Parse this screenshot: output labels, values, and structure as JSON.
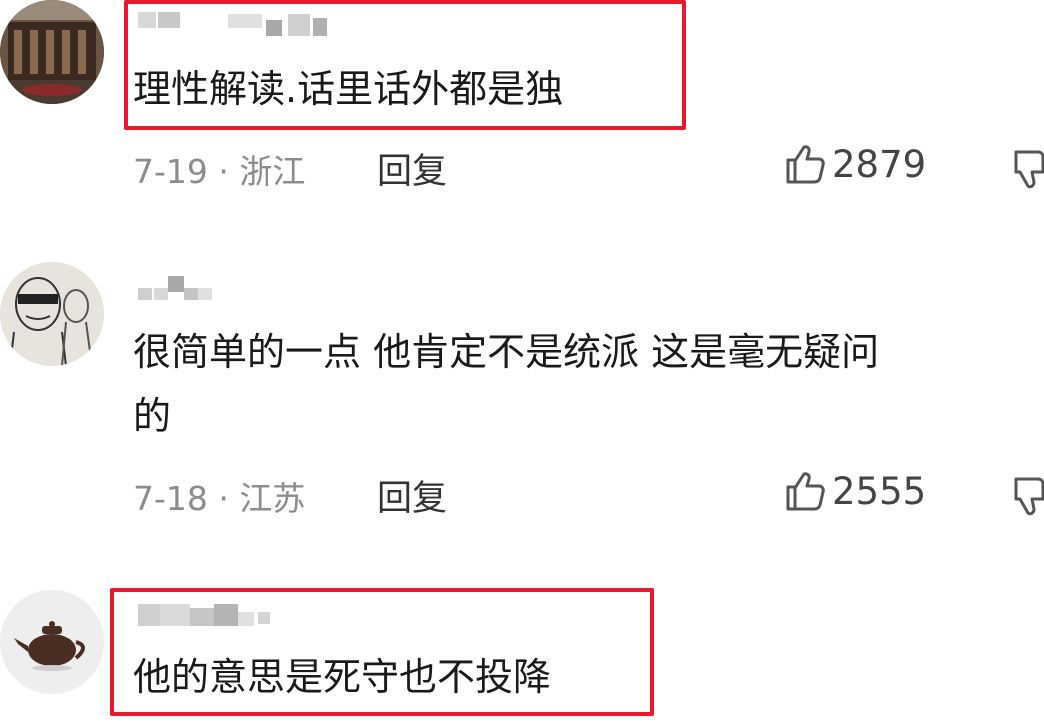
{
  "comments": [
    {
      "text": "理性解读.话里话外都是独",
      "date_location": "7-19 · 浙江",
      "reply_label": "回复",
      "likes": "2879",
      "highlighted": true,
      "avatar": "building-photo-avatar"
    },
    {
      "text_line1": "很简单的一点 他肯定不是统派 这是毫无疑问",
      "text_line2": "的",
      "date_location": "7-18 · 江苏",
      "reply_label": "回复",
      "likes": "2555",
      "highlighted": false,
      "avatar": "sketch-drawing-avatar"
    },
    {
      "text": "他的意思是死守也不投降",
      "highlighted": true,
      "avatar": "teapot-avatar"
    }
  ],
  "colors": {
    "highlight": "#e8192c",
    "meta": "#8c8c8c",
    "text": "#1a1a1a"
  }
}
